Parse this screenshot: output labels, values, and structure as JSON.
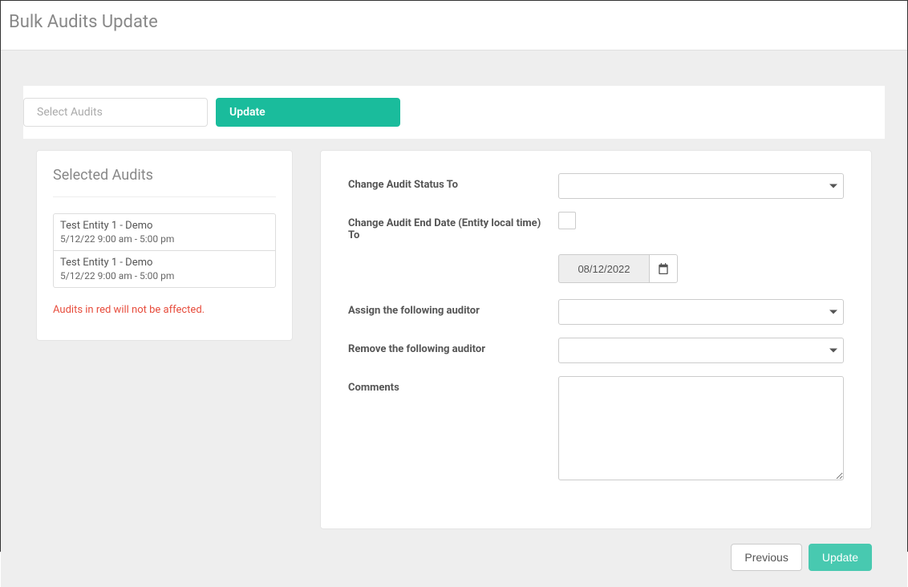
{
  "header": {
    "title": "Bulk Audits Update"
  },
  "tabs": {
    "select_label": "Select Audits",
    "update_label": "Update"
  },
  "left": {
    "title": "Selected Audits",
    "audits": [
      {
        "name": "Test Entity 1 - Demo",
        "time": "5/12/22 9:00 am - 5:00 pm"
      },
      {
        "name": "Test Entity 1 - Demo",
        "time": "5/12/22 9:00 am - 5:00 pm"
      }
    ],
    "warning": "Audits in red will not be affected."
  },
  "form": {
    "status_label": "Change Audit Status To",
    "enddate_label": "Change Audit End Date (Entity local time) To",
    "date_value": "08/12/2022",
    "assign_label": "Assign the following auditor",
    "remove_label": "Remove the following auditor",
    "comments_label": "Comments"
  },
  "footer": {
    "previous": "Previous",
    "update": "Update"
  }
}
